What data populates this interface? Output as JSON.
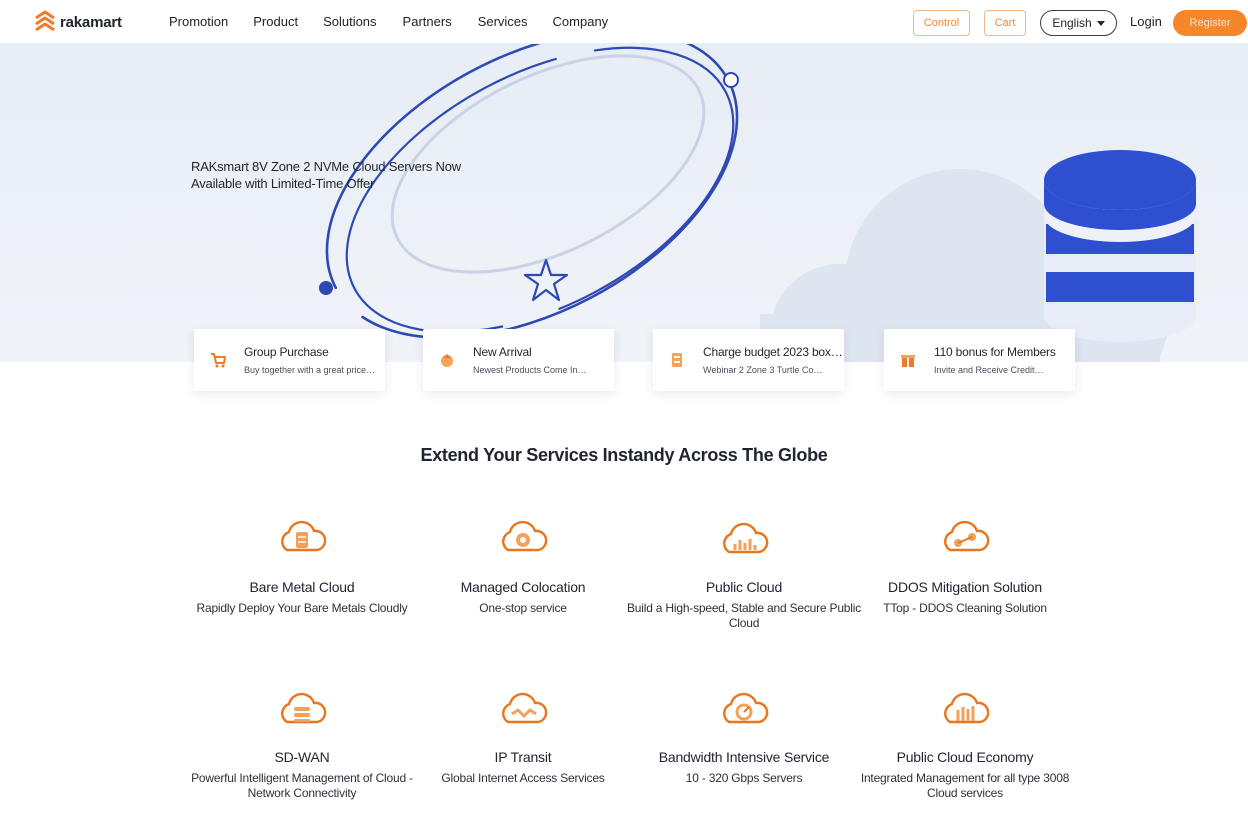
{
  "header": {
    "brand": "rakamart",
    "nav": [
      "Promotion",
      "Product",
      "Solutions",
      "Partners",
      "Services",
      "Company"
    ],
    "console_label": "Control",
    "cart_label": "Cart",
    "language": "English",
    "login_label": "Login",
    "register_label": "Register"
  },
  "hero": {
    "line1": "RAKsmart 8V Zone 2 NVMe Cloud Servers Now",
    "line2": "Available with Limited-Time Offer"
  },
  "feature_cards": [
    {
      "icon": "cart-icon",
      "title": "Group Purchase",
      "subtitle": "Buy together with a great price…"
    },
    {
      "icon": "new-icon",
      "title": "New Arrival",
      "subtitle": "Newest Products Come In…"
    },
    {
      "icon": "server-icon",
      "title": "Charge budget 2023 box…",
      "subtitle": "Webinar 2 Zone 3 Turtle Co…"
    },
    {
      "icon": "gift-icon",
      "title": "110 bonus for Members",
      "subtitle": "Invite and Receive Credit…"
    }
  ],
  "services_heading": "Extend Your Services Instandy Across The Globe",
  "services": [
    {
      "icon": "bare-metal-cloud-icon",
      "title": "Bare Metal Cloud",
      "desc": "Rapidly Deploy Your Bare Metals Cloudly"
    },
    {
      "icon": "colocation-icon",
      "title": "Managed Colocation",
      "desc": "One-stop service"
    },
    {
      "icon": "public-cloud-icon",
      "title": "Public Cloud",
      "desc": "Build a High-speed, Stable and Secure Public Cloud"
    },
    {
      "icon": "ddos-icon",
      "title": "DDOS Mitigation Solution",
      "desc": "TTop - DDOS Cleaning Solution"
    },
    {
      "icon": "sd-wan-icon",
      "title": "SD-WAN",
      "desc": "Powerful Intelligent Management of Cloud - Network Connectivity"
    },
    {
      "icon": "ip-transit-icon",
      "title": "IP Transit",
      "desc": "Global Internet Access Services"
    },
    {
      "icon": "bandwidth-icon",
      "title": "Bandwidth Intensive Service",
      "desc": "10 - 320 Gbps Servers"
    },
    {
      "icon": "cloud-economy-icon",
      "title": "Public Cloud Economy",
      "desc": "Integrated Management for all type 3008 Cloud services"
    }
  ],
  "colors": {
    "accent": "#f5862a",
    "hero_blue": "#2f4bb8",
    "bg": "#e9eef6"
  }
}
